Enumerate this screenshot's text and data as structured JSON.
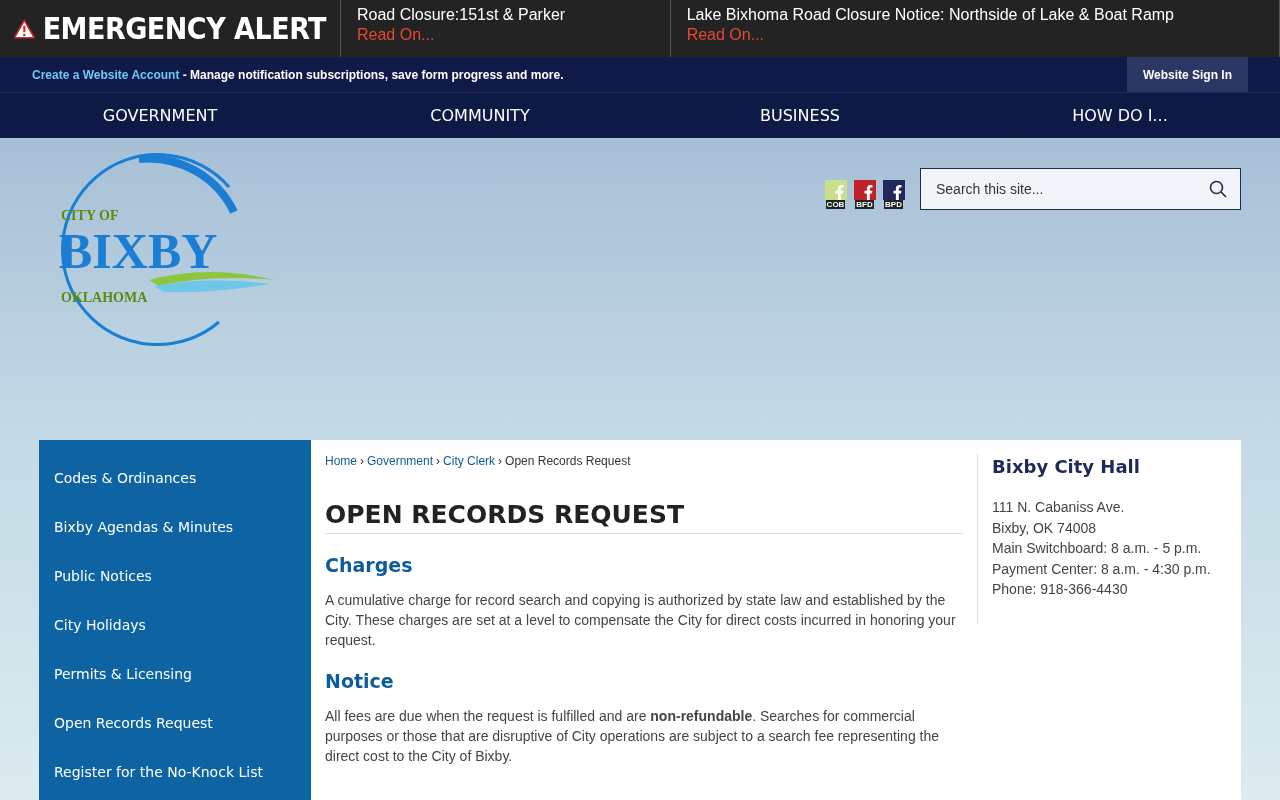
{
  "alert_bar": {
    "title": "EMERGENCY ALERT",
    "alerts": [
      {
        "headline": "Road Closure:151st & Parker",
        "link": "Read On..."
      },
      {
        "headline": "Lake Bixhoma Road Closure Notice: Northside of Lake & Boat Ramp",
        "link": "Read On..."
      }
    ]
  },
  "account_bar": {
    "link": "Create a Website Account",
    "text": "- Manage notification subscriptions, save form progress and more.",
    "sign_in": "Website Sign In"
  },
  "nav": [
    "GOVERNMENT",
    "COMMUNITY",
    "BUSINESS",
    "HOW DO I..."
  ],
  "logo": {
    "top": "CITY OF",
    "name": "BIXBY",
    "bottom": "OKLAHOMA"
  },
  "social": [
    {
      "label": "COB",
      "color": "#c8e08a"
    },
    {
      "label": "BFD",
      "color": "#c0222c"
    },
    {
      "label": "BPD",
      "color": "#1f2a5a"
    }
  ],
  "search": {
    "placeholder": "Search this site..."
  },
  "sidebar": [
    "Codes & Ordinances",
    "Bixby Agendas & Minutes",
    "Public Notices",
    "City Holidays",
    "Permits & Licensing",
    "Open Records Request",
    "Register for the No-Knock List"
  ],
  "breadcrumb": {
    "separator": "›",
    "items": [
      {
        "label": "Home",
        "kind": "link"
      },
      {
        "label": "Government",
        "kind": "link"
      },
      {
        "label": "City Clerk",
        "kind": "link"
      },
      {
        "label": "Open Records Request",
        "kind": "current"
      }
    ]
  },
  "page_title": "OPEN RECORDS REQUEST",
  "sections": [
    {
      "heading": "Charges",
      "text": "A cumulative charge for record search and copying is authorized by state law and established by the City. These charges are set at a level to compensate the City for direct costs incurred in honoring your request."
    },
    {
      "heading": "Notice",
      "text": "All fees are due when the request is fulfilled and are **non-refundable**. Searches for commercial purposes or those that are disruptive of City operations are subject to a search fee representing the direct cost to the City of Bixby."
    }
  ],
  "contact": {
    "title": "Bixby City Hall",
    "lines": [
      "111 N. Cabaniss Ave.",
      "Bixby, OK 74008",
      "Main Switchboard: 8 a.m. - 5 p.m.",
      "Payment Center: 8 a.m. - 4:30 p.m.",
      "Phone: 918-366-4430"
    ]
  }
}
